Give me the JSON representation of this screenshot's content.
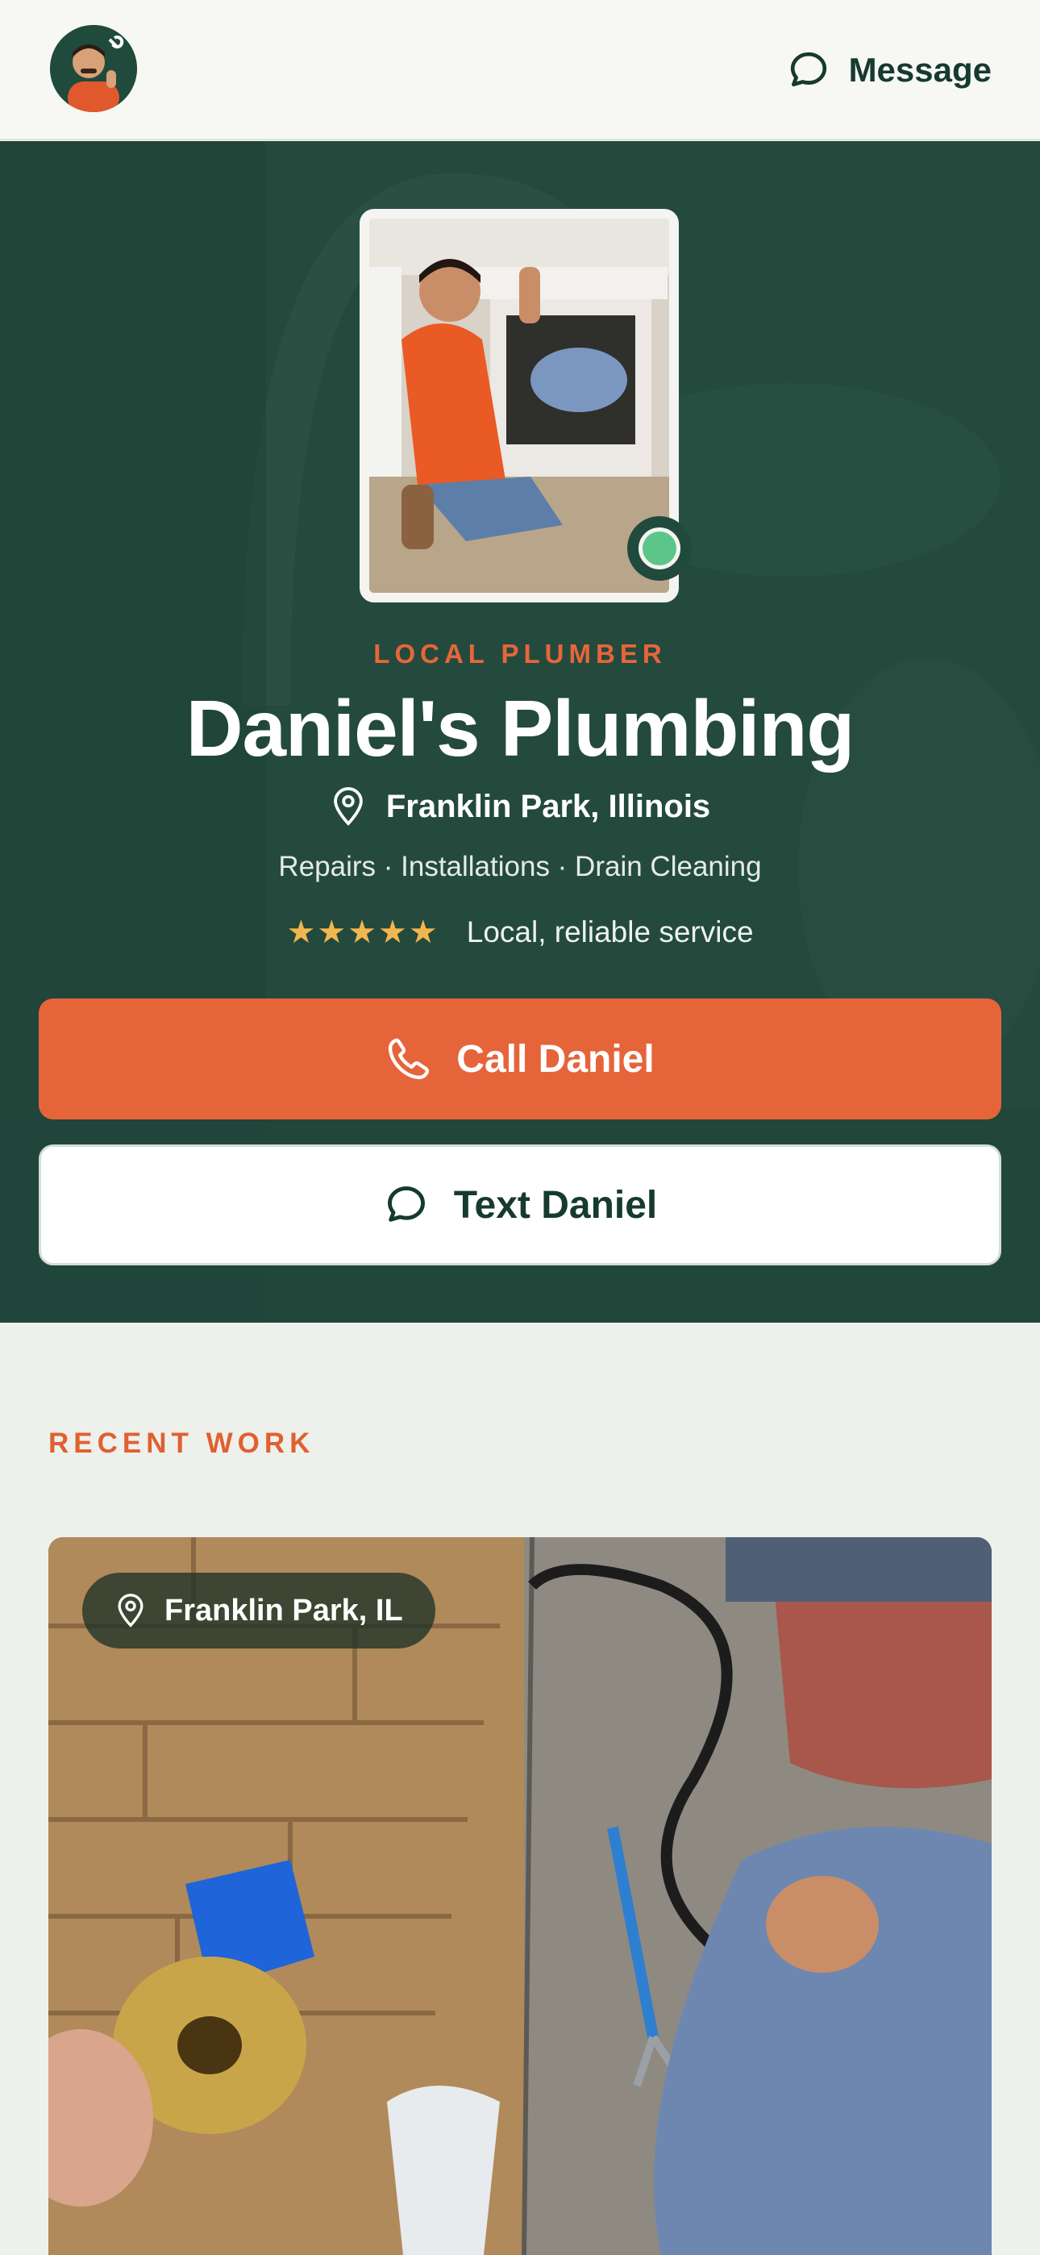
{
  "header": {
    "message_label": "Message",
    "avatar_icon": "plumber-avatar-icon",
    "message_icon": "chat-bubble-icon"
  },
  "hero": {
    "eyebrow": "LOCAL PLUMBER",
    "business_name": "Daniel's Plumbing",
    "location": "Franklin Park, Illinois",
    "services": "Repairs · Installations · Drain Cleaning",
    "stars": "★★★★★",
    "rating_text": "Local, reliable service",
    "call_label": "Call Daniel",
    "text_label": "Text Daniel",
    "status": "online"
  },
  "recent_work": {
    "section_label": "RECENT WORK",
    "items": [
      {
        "location": "Franklin Park, IL"
      }
    ]
  },
  "colors": {
    "brand_green": "#234a3d",
    "accent_orange": "#e6643a",
    "star_yellow": "#f3b64f",
    "online_green": "#5cc58a"
  }
}
